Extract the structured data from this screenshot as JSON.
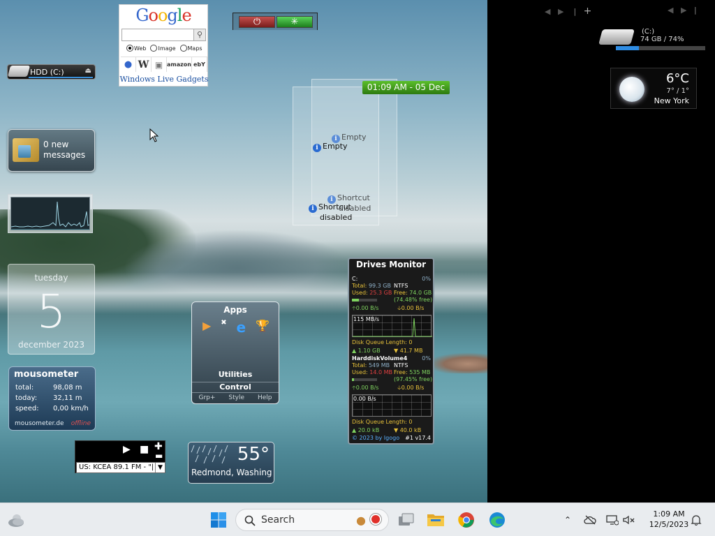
{
  "google_gadget": {
    "logo": [
      "G",
      "o",
      "o",
      "g",
      "l",
      "e"
    ],
    "search_placeholder": "",
    "options": [
      {
        "label": "Web",
        "selected": true
      },
      {
        "label": "Image",
        "selected": false
      },
      {
        "label": "Maps",
        "selected": false
      }
    ],
    "sites": [
      "W",
      "amazon",
      "ebY"
    ],
    "footer": "Windows Live Gadgets"
  },
  "hdd_gadget": {
    "label": "HDD (C:)"
  },
  "mail_gadget": {
    "line1": "0 new",
    "line2": "messages"
  },
  "calendar": {
    "weekday": "tuesday",
    "day": "5",
    "month_year": "december 2023"
  },
  "mousometer": {
    "title": "mousometer",
    "rows": [
      {
        "label": "total:",
        "value": "98,08 m"
      },
      {
        "label": "today:",
        "value": "32,11 m"
      },
      {
        "label": "speed:",
        "value": "0,00 km/h"
      }
    ],
    "footer": "mousometer.de",
    "status": "offline"
  },
  "radio": {
    "station": "US: KCEA 89.1 FM - \"|"
  },
  "shortcut_panels": {
    "empty_label": "Empty",
    "disabled_line1": "Shortcut",
    "disabled_line2": "disabled"
  },
  "clock": {
    "text": "01:09 AM - 05 Dec"
  },
  "apps": {
    "title": "Apps",
    "utilities": "Utilities",
    "control": "Control",
    "footer": [
      "Grp+",
      "Style",
      "Help"
    ]
  },
  "weather_small": {
    "temp": "55°",
    "city": "Redmond, Washing"
  },
  "drives_monitor": {
    "title": "Drives Monitor",
    "drive1": {
      "name": "C:",
      "pct": "0%",
      "total_label": "Total:",
      "total": "99.3 GB",
      "fs": "NTFS",
      "used_label": "Used:",
      "used": "25.3 GB",
      "free_label": "Free:",
      "free": "74.0 GB",
      "free_pct": "(74.48% free)",
      "read": "0.00 B/s",
      "write": "0.00 B/s",
      "graph_label": "115 MB/s",
      "queue": "Disk Queue Length: 0",
      "r_total": "1.10 GB",
      "w_total": "41.7 MB"
    },
    "drive2": {
      "name": "HarddiskVolume4",
      "pct": "0%",
      "total_label": "Total:",
      "total": "549 MB",
      "fs": "NTFS",
      "used_label": "Used:",
      "used": "14.0 MB",
      "free_label": "Free:",
      "free": "535 MB",
      "free_pct": "(97.45% free)",
      "read": "0.00 B/s",
      "write": "0.00 B/s",
      "graph_label": "0.00 B/s",
      "queue": "Disk Queue Length: 0",
      "r_total": "20.0 kB",
      "w_total": "40.0 kB"
    },
    "footer_left": "© 2023 by Igogo",
    "footer_right": "#1 v17.4"
  },
  "right_pane": {
    "drive": {
      "label": "(C:)",
      "usage": "74 GB / 74%",
      "used_fraction": 0.26
    },
    "weather": {
      "temp": "6°C",
      "range": "7° / 1°",
      "city": "New York"
    }
  },
  "taskbar": {
    "search_label": "Search",
    "time": "1:09 AM",
    "date": "12/5/2023"
  }
}
